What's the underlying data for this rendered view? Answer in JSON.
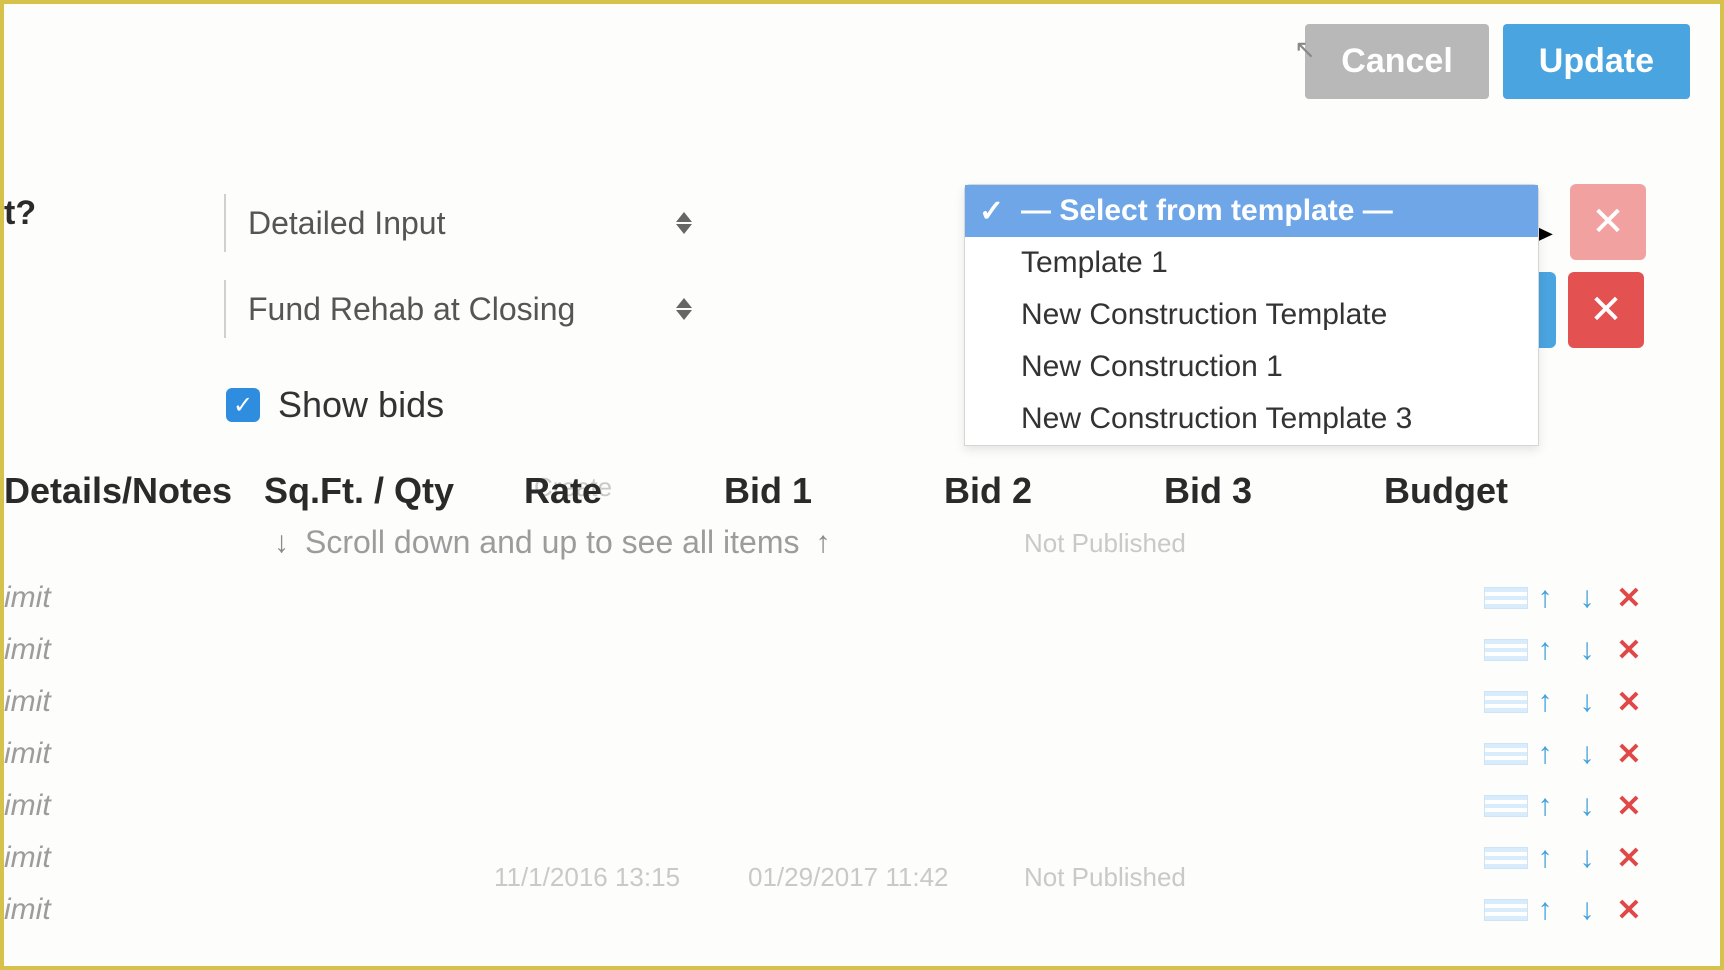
{
  "actions": {
    "cancel": "Cancel",
    "update": "Update"
  },
  "left_partial_label": "t?",
  "selects": {
    "input_mode": "Detailed Input",
    "funding": "Fund Rehab at Closing"
  },
  "template_dropdown": {
    "placeholder": "— Select from template —",
    "options": [
      "Template 1",
      "New Construction Template",
      "New Construction 1",
      "New Construction Template 3"
    ]
  },
  "show_bids_label": "Show bids",
  "columns": {
    "details": "Details/Notes",
    "sqft": "Sq.Ft. / Qty",
    "rate": "Rate",
    "bid1": "Bid 1",
    "bid2": "Bid 2",
    "bid3": "Bid 3",
    "budget": "Budget"
  },
  "scroll_hint": "Scroll down and up to see all items",
  "row_placeholder": "imit",
  "row_count": 7,
  "ghost": {
    "create": "Create",
    "not_published": "Not Published",
    "date1": "11/1/2016 13:15",
    "date2": "01/29/2017 11:42"
  }
}
